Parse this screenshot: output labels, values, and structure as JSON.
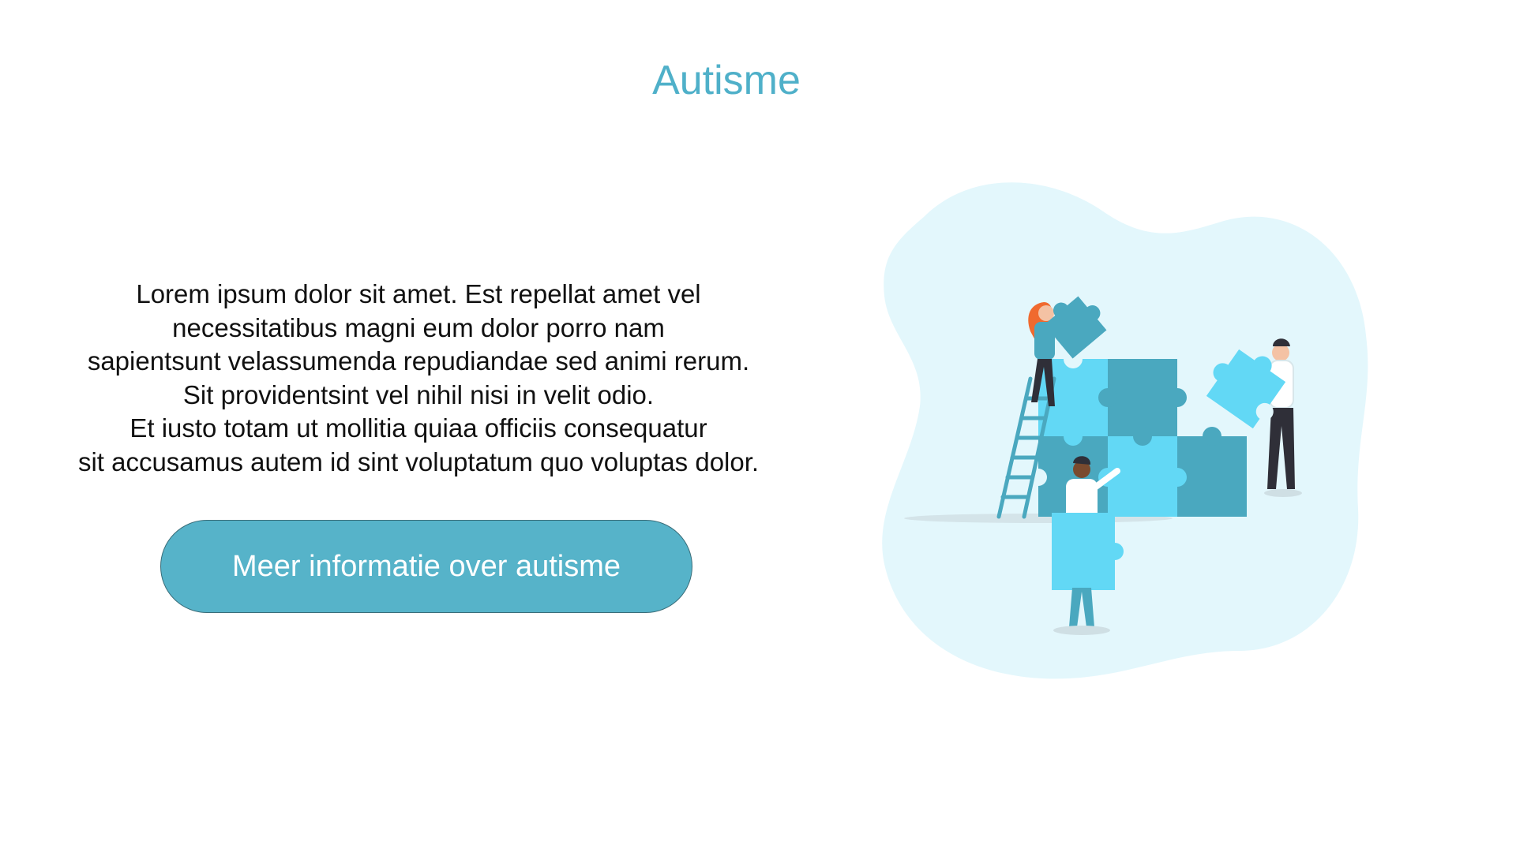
{
  "page": {
    "title": "Autisme"
  },
  "intro": {
    "lines": [
      "Lorem ipsum dolor sit amet. Est repellat amet vel",
      "necessitatibus magni eum dolor porro nam",
      "sapientsunt velassumenda repudiandae sed animi rerum.",
      "Sit providentsint vel nihil nisi in velit odio.",
      "Et iusto totam ut mollitia quiaa officiis consequatur",
      "sit accusamus autem id sint voluptatum quo voluptas dolor."
    ]
  },
  "cta": {
    "label": "Meer informatie over autisme"
  },
  "colors": {
    "accent": "#4fb0c9",
    "button": "#56b3c9",
    "blob": "#e3f7fc",
    "puzzle_light": "#62d8f5",
    "puzzle_dark": "#4aa8bf"
  },
  "illustration": {
    "icon": "people-assembling-puzzle-illustration"
  }
}
